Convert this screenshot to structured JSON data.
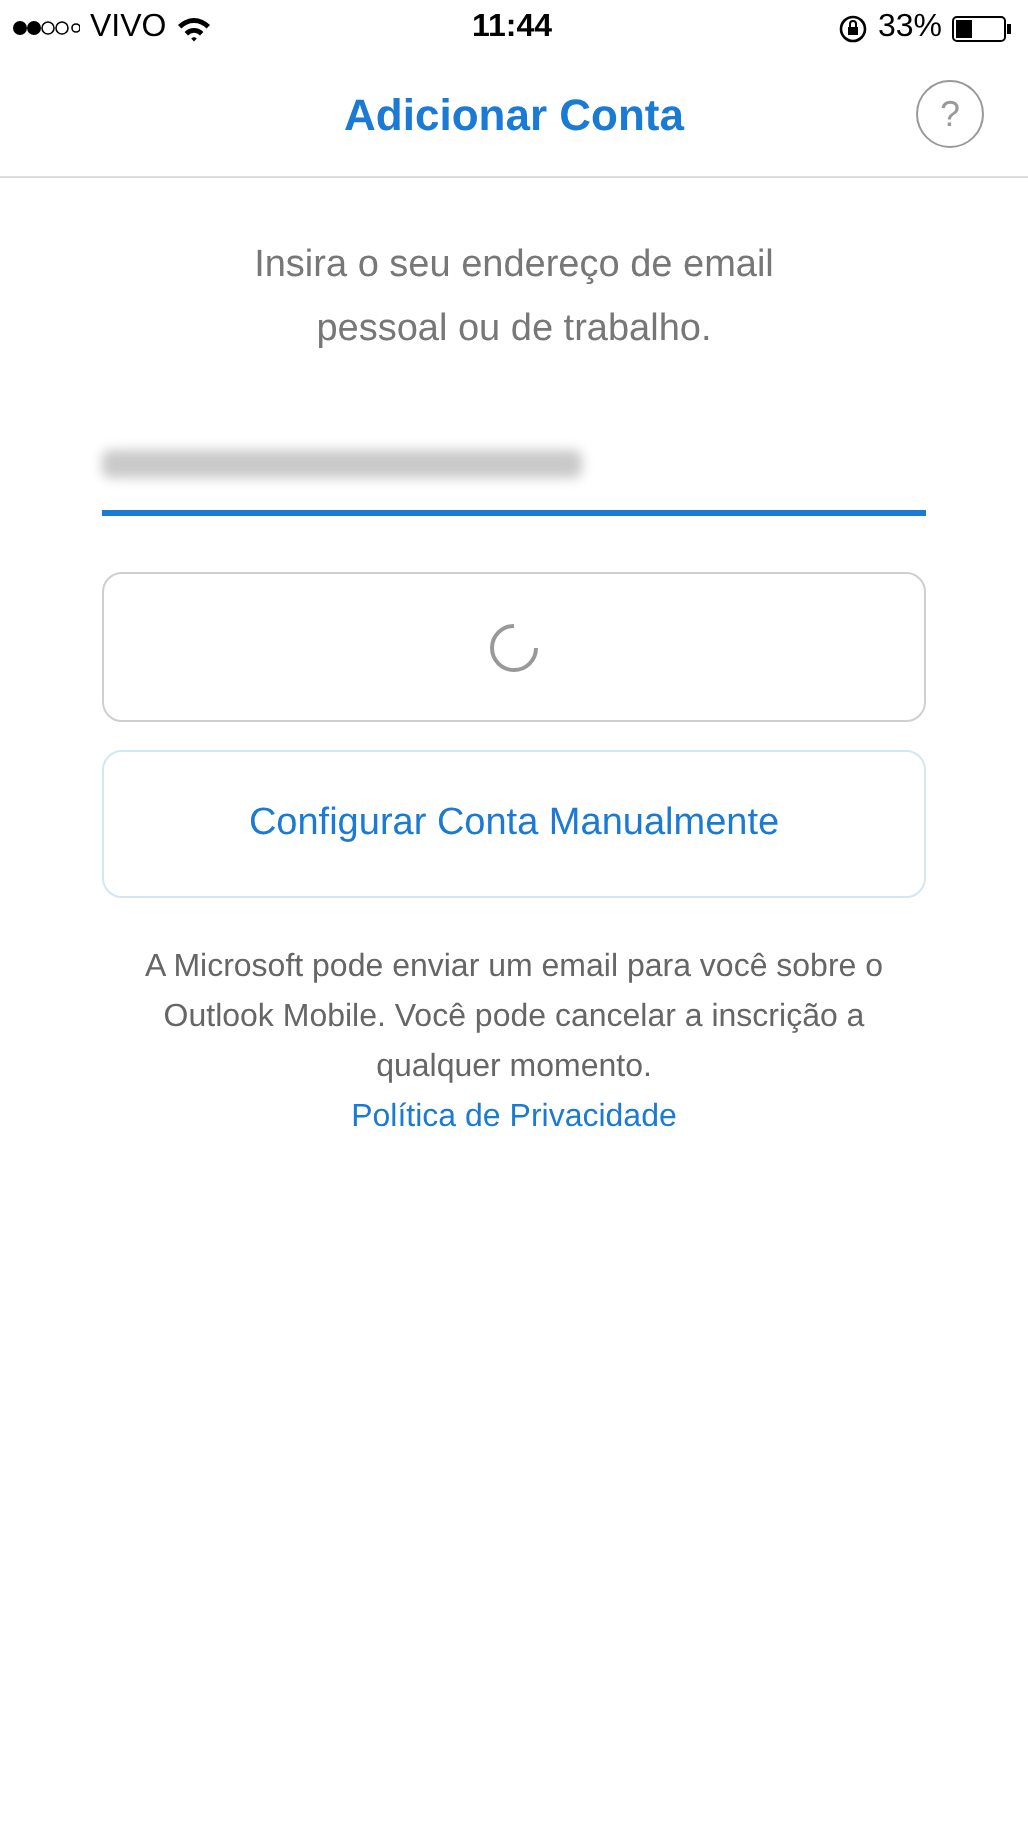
{
  "status_bar": {
    "carrier": "VIVO",
    "time": "11:44",
    "battery_percent": "33%"
  },
  "nav": {
    "title": "Adicionar Conta",
    "help": "?"
  },
  "prompt": "Insira o seu endereço de email pessoal ou de trabalho.",
  "email_field": {
    "focused": true,
    "redacted": true
  },
  "sign_in_button": {
    "loading": true
  },
  "manual_button": {
    "label": "Configurar Conta Manualmente"
  },
  "disclaimer": "A Microsoft pode enviar um email para você sobre o Outlook Mobile. Você pode cancelar a inscrição a qualquer momento.",
  "privacy_link": "Política de Privacidade"
}
